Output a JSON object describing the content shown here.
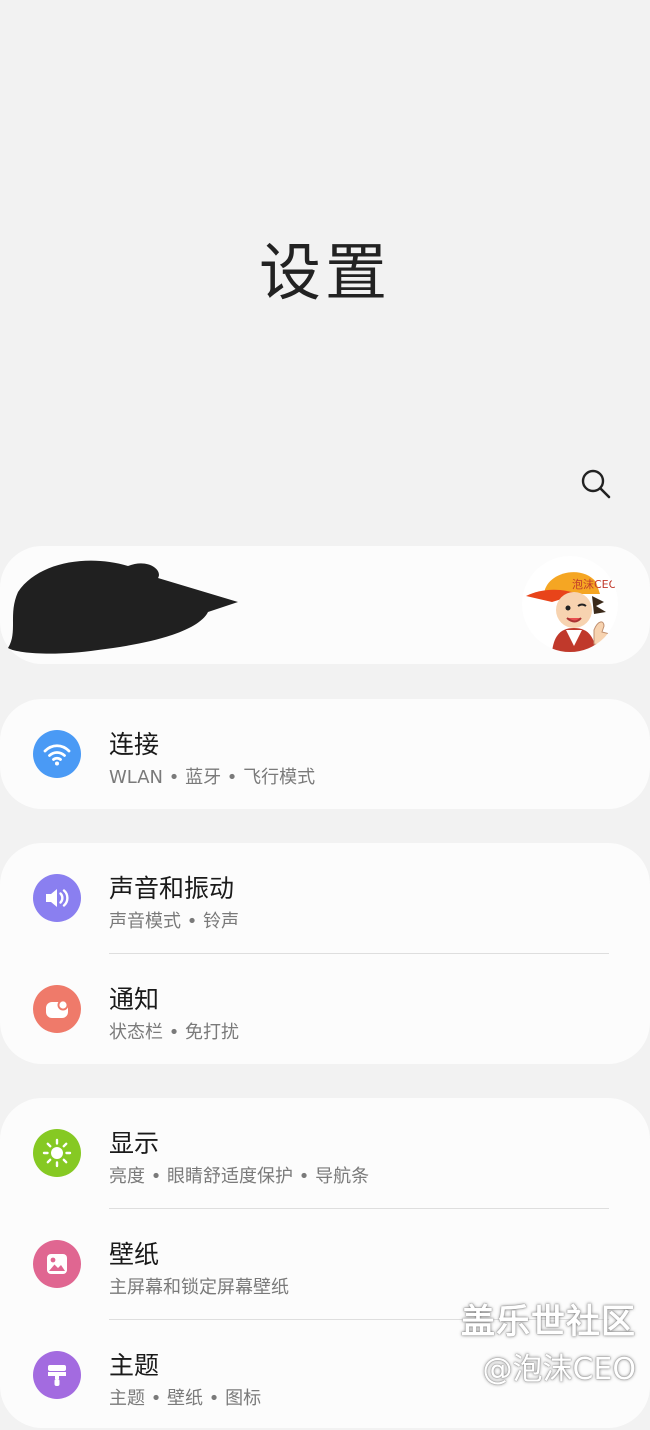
{
  "header": {
    "title": "设置"
  },
  "profile": {
    "name_redacted": true,
    "avatar_label": "泡沫CEO"
  },
  "groups": [
    {
      "rows": [
        {
          "title": "连接",
          "subtitle": "WLAN • 蓝牙 • 飞行模式",
          "icon": "wifi-icon",
          "color": "#4a9af5"
        }
      ]
    },
    {
      "rows": [
        {
          "title": "声音和振动",
          "subtitle": "声音模式 • 铃声",
          "icon": "speaker-icon",
          "color": "#8a7ff0"
        },
        {
          "title": "通知",
          "subtitle": "状态栏 • 免打扰",
          "icon": "notification-icon",
          "color": "#ef7a6a"
        }
      ]
    },
    {
      "rows": [
        {
          "title": "显示",
          "subtitle": "亮度 • 眼睛舒适度保护 • 导航条",
          "icon": "sun-icon",
          "color": "#86c923"
        },
        {
          "title": "壁纸",
          "subtitle": "主屏幕和锁定屏幕壁纸",
          "icon": "image-icon",
          "color": "#e06691"
        },
        {
          "title": "主题",
          "subtitle": "主题 • 壁纸 • 图标",
          "icon": "paint-brush-icon",
          "color": "#a36be0"
        }
      ]
    }
  ],
  "watermark": {
    "line1": "盖乐世社区",
    "line2": "@泡沫CEO"
  }
}
